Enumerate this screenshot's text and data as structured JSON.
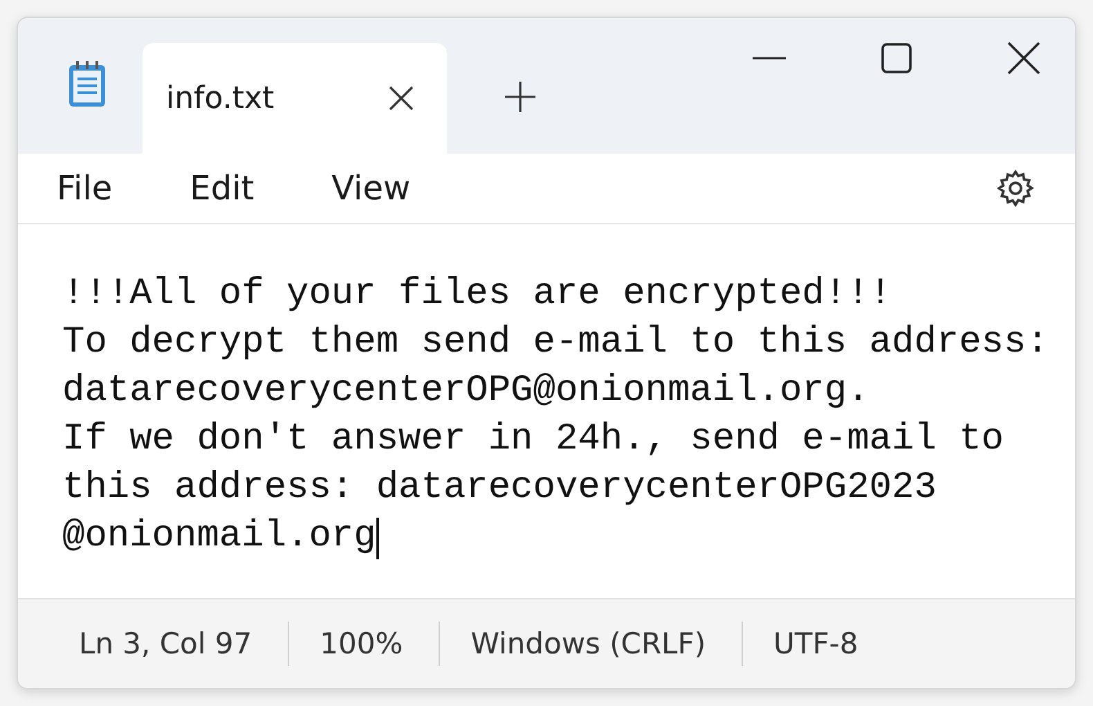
{
  "tabs": [
    {
      "label": "info.txt",
      "selected": true
    }
  ],
  "menu": [
    "File",
    "Edit",
    "View"
  ],
  "content": [
    "!!!All of your files are encrypted!!!",
    "To decrypt them send e-mail to this address:",
    "datarecoverycenterOPG@onionmail.org.",
    "If we don't answer in 24h., send e-mail to",
    "this address: datarecoverycenterOPG2023",
    "@onionmail.org"
  ],
  "status_bar": [
    "Ln 3, Col 97",
    "100%",
    "Windows (CRLF)",
    "UTF-8"
  ]
}
